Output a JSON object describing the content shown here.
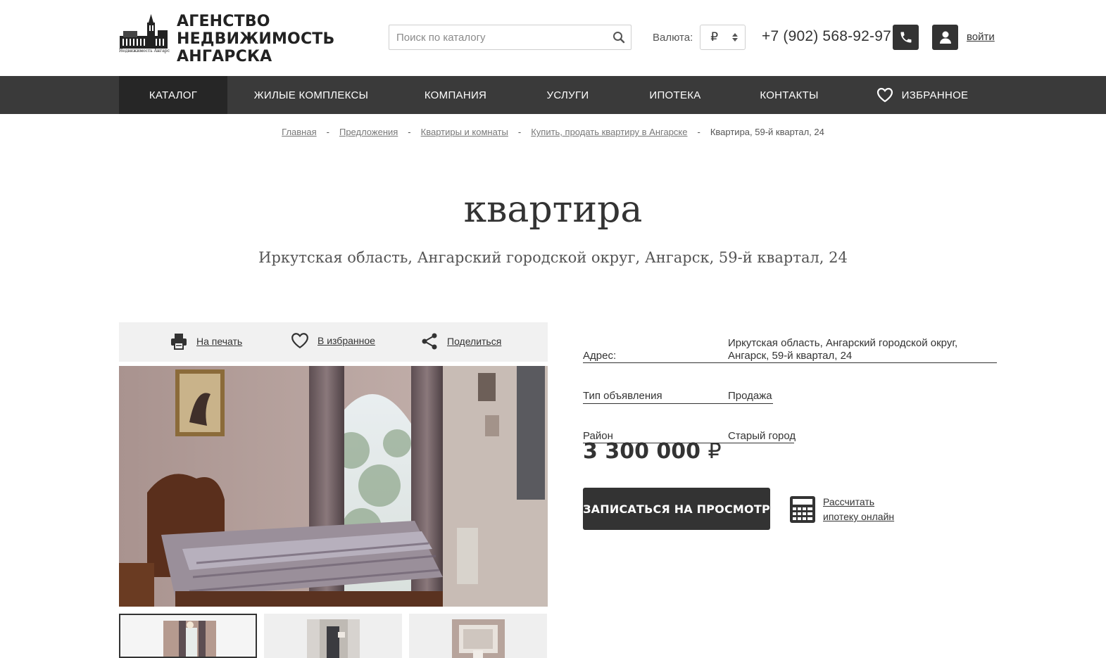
{
  "logo": {
    "line1": "АГЕНСТВО",
    "line2": "НЕДВИЖИМОСТЬ",
    "line3": "АНГАРСКА",
    "tagline": "Недвижимость Ангарска"
  },
  "search": {
    "placeholder": "Поиск по каталогу"
  },
  "currency": {
    "label": "Валюта:",
    "selected": "₽"
  },
  "phone": "+7 (902) 568-92-97",
  "login": "войти",
  "nav": {
    "items": [
      {
        "label": "КАТАЛОГ",
        "active": true
      },
      {
        "label": "ЖИЛЫЕ КОМПЛЕКСЫ"
      },
      {
        "label": "КОМПАНИЯ"
      },
      {
        "label": "УСЛУГИ"
      },
      {
        "label": "ИПОТЕКА"
      },
      {
        "label": "КОНТАКТЫ"
      },
      {
        "label": "ИЗБРАННОЕ",
        "icon": "heart-icon"
      }
    ]
  },
  "breadcrumb": {
    "items": [
      "Главная",
      "Предложения",
      "Квартиры и комнаты",
      "Купить, продать квартиру в Ангарске"
    ],
    "current": "Квартира, 59-й квартал, 24",
    "separator": "-"
  },
  "title": "квартира",
  "subtitle": "Иркутская область, Ангарский городской округ, Ангарск, 59-й квартал, 24",
  "actions": {
    "print": "На печать",
    "favorite": "В избранное",
    "share": "Поделиться"
  },
  "props": {
    "address_label": "Адрес:",
    "address_line1": "Иркутская область, Ангарский городской округ,",
    "address_line2": "Ангарск, 59-й квартал, 24",
    "type_label": "Тип объявления",
    "type_value": "Продажа",
    "district_label": "Район",
    "district_value": "Старый город"
  },
  "price": {
    "amount": "3 300 000",
    "currency": "₽"
  },
  "book_button": "ЗАПИСАТЬСЯ НА ПРОСМОТР",
  "calc": {
    "line1": "Рассчитать",
    "line2": "ипотеку онлайн"
  },
  "colors": {
    "dark": "#333333",
    "nav": "#3a3a3a",
    "nav_active": "#262626"
  }
}
